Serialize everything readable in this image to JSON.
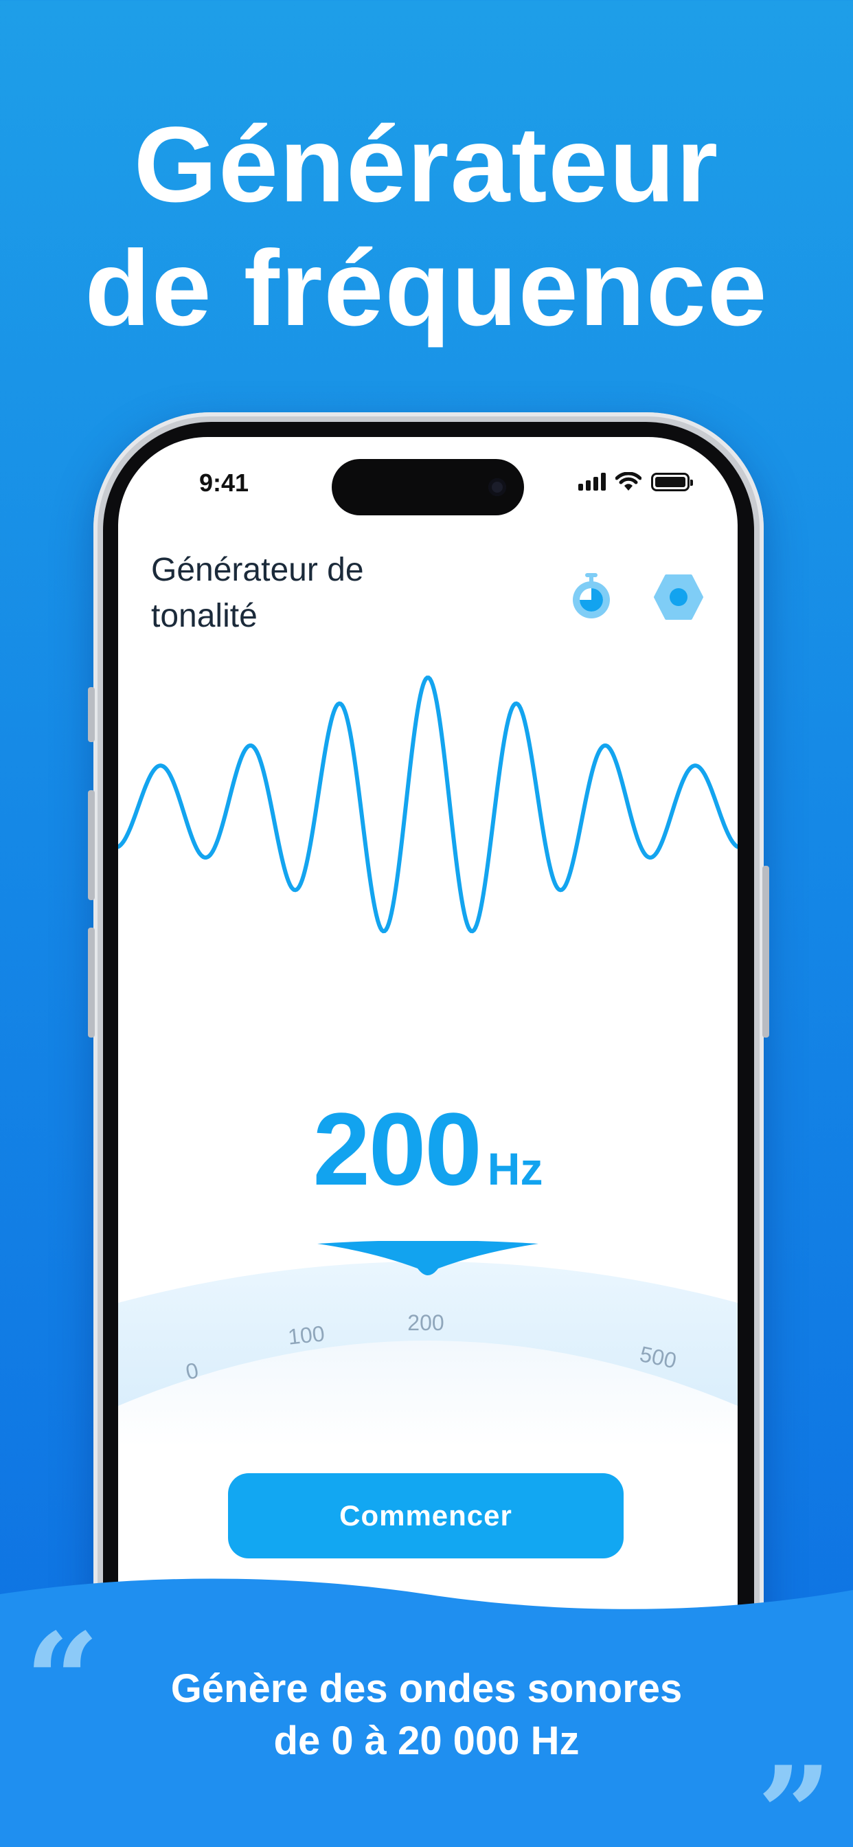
{
  "promo": {
    "headline_line1": "Générateur",
    "headline_line2": "de fréquence",
    "tagline_line1": "Génère des ondes sonores",
    "tagline_line2": "de 0 à 20 000 Hz",
    "quote_open": "“",
    "quote_close": "”"
  },
  "status_bar": {
    "time": "9:41",
    "icons": [
      "signal-icon",
      "wifi-icon",
      "battery-icon"
    ]
  },
  "header": {
    "title": "Générateur de tonalité",
    "timer_icon": "timer-icon",
    "settings_icon": "settings-icon"
  },
  "frequency": {
    "value": "200",
    "unit": "Hz"
  },
  "dial": {
    "ticks": [
      "0",
      "100",
      "200",
      "500"
    ],
    "selected": "200"
  },
  "actions": {
    "start_label": "Commencer"
  },
  "colors": {
    "accent": "#12a3ef",
    "background_top": "#1e9ee8",
    "background_bottom": "#0d6fe2",
    "title_text": "#1b2a3a"
  }
}
